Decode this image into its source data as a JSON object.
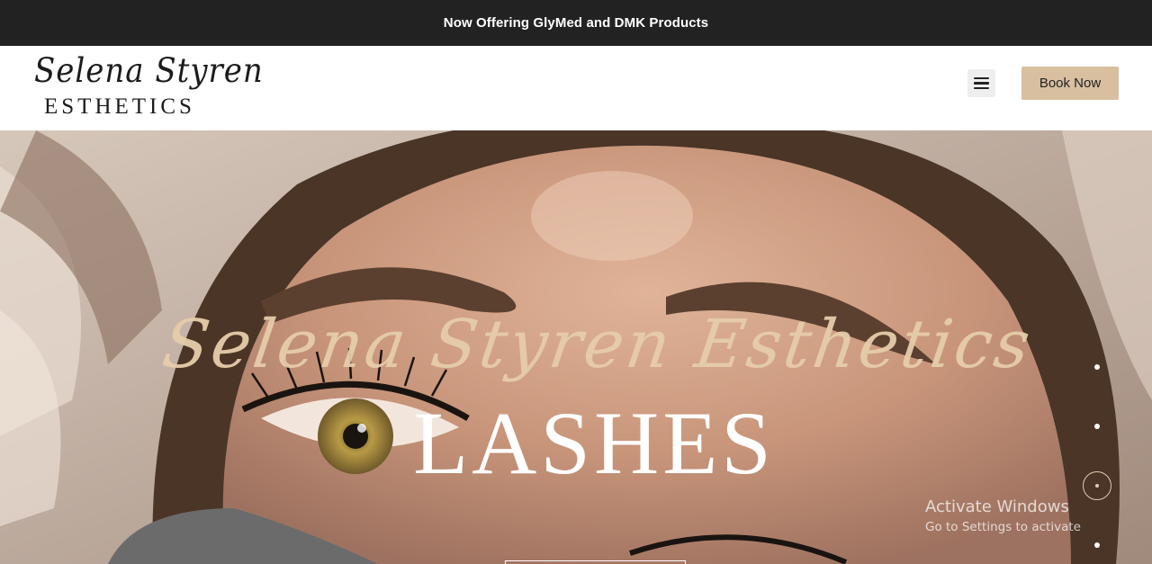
{
  "announcement": {
    "text": "Now Offering GlyMed and DMK Products"
  },
  "header": {
    "logo": {
      "script": "Selena Styren",
      "word": "ESTHETICS"
    },
    "menu_icon": "hamburger-menu-icon",
    "book_button": "Book Now"
  },
  "hero": {
    "script_title": "Selena Styren Esthetics",
    "title": "LASHES",
    "slides": {
      "count": 4,
      "active": 3
    }
  },
  "watermark": {
    "line1": "Activate Windows",
    "line2": "Go to Settings to activate"
  },
  "colors": {
    "topbar_bg": "#222222",
    "accent": "#d8bfa0",
    "script_gold": "#e6cdaa"
  }
}
